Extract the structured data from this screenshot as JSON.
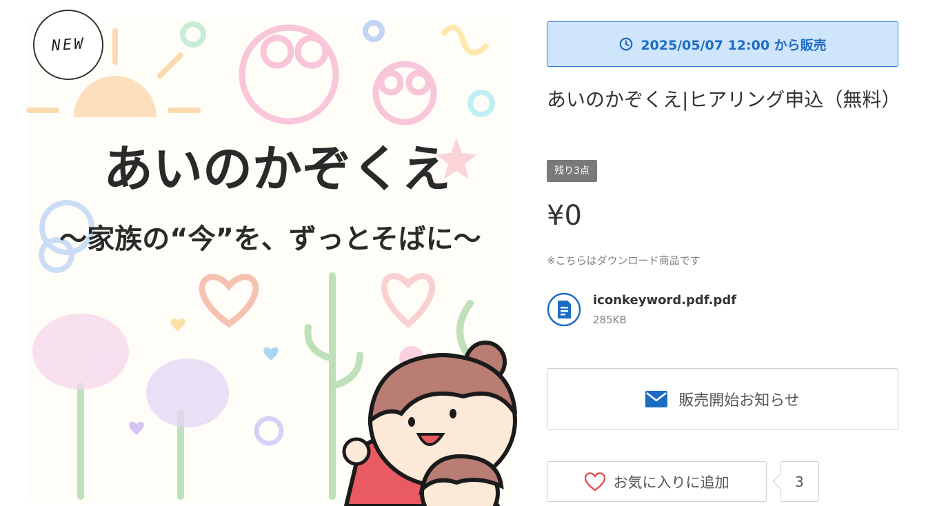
{
  "image": {
    "new_badge": "NEW",
    "artwork_title": "あいのかぞくえ",
    "artwork_subtitle": "〜家族の“今”を、ずっとそばに〜"
  },
  "sale": {
    "icon": "clock-icon",
    "label": "2025/05/07 12:00 から販売"
  },
  "product": {
    "title": "あいのかぞくえ|ヒアリング申込（無料）",
    "stock_badge": "残り3点",
    "price": "¥0",
    "download_note": "※こちらはダウンロード商品です"
  },
  "file": {
    "icon": "document-icon",
    "name": "iconkeyword.pdf.pdf",
    "size": "285KB"
  },
  "notify": {
    "icon": "mail-icon",
    "label": "販売開始お知らせ"
  },
  "favorite": {
    "icon": "heart-icon",
    "label": "お気に入りに追加",
    "count": "3"
  },
  "colors": {
    "accent": "#1d6cc4",
    "banner_bg": "#cfe5fb",
    "heart": "#e05050",
    "badge_bg": "#7a7a7a"
  }
}
